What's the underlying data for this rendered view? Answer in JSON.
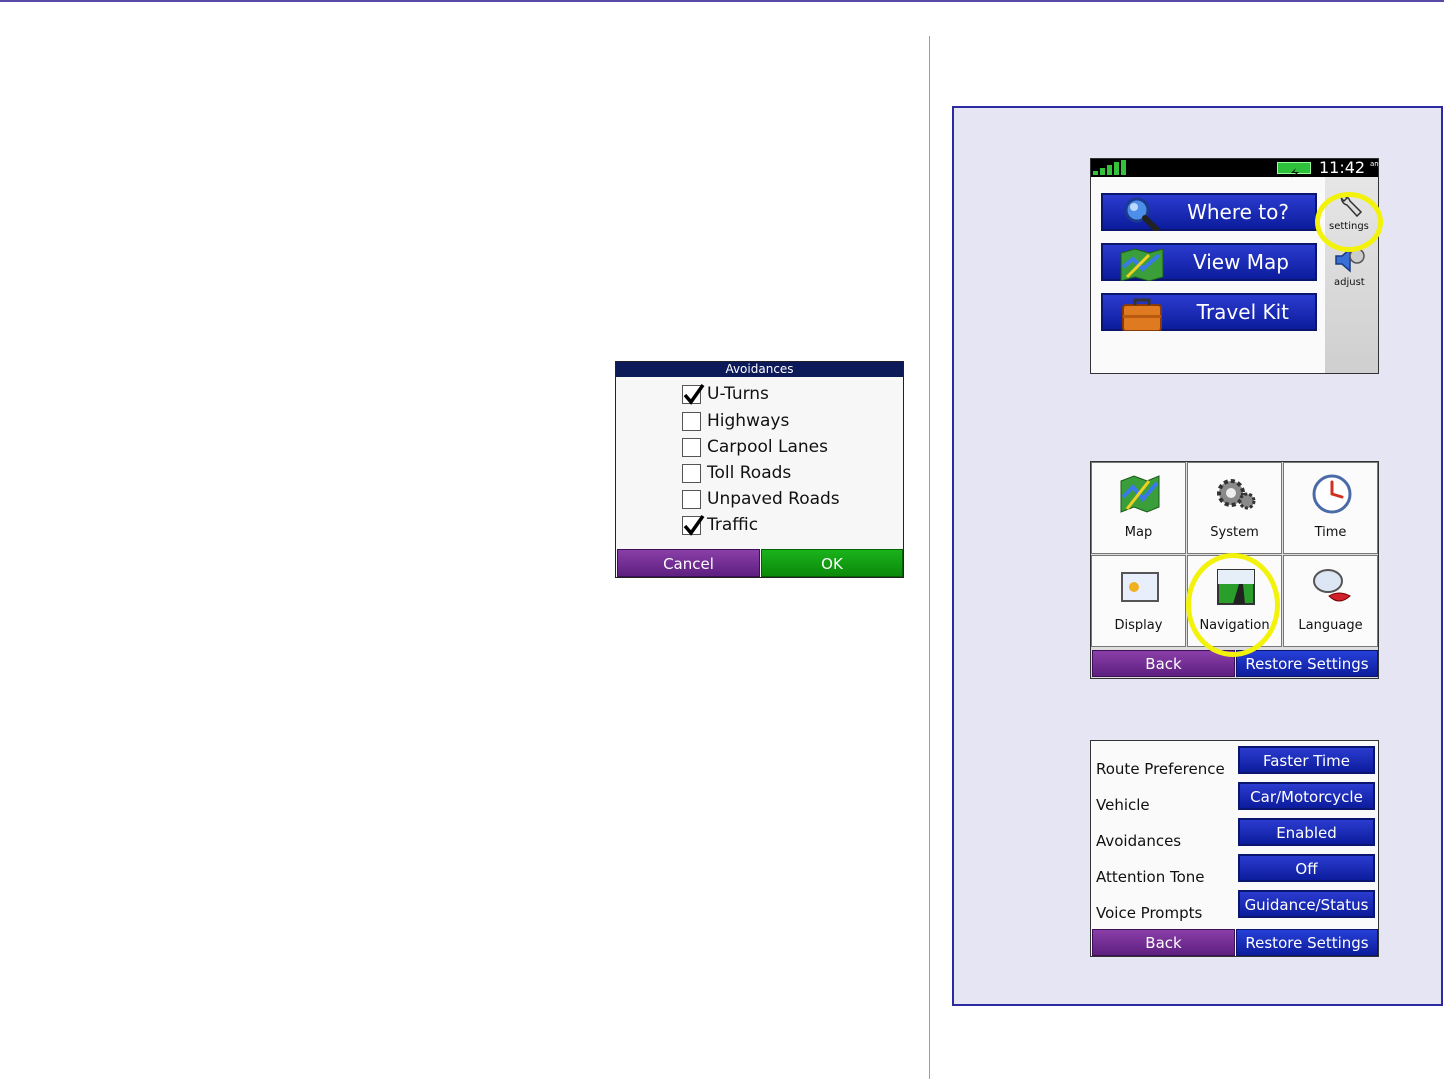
{
  "avoidances_dialog": {
    "title": "Avoidances",
    "items": [
      {
        "label": "U-Turns",
        "checked": true
      },
      {
        "label": "Highways",
        "checked": false
      },
      {
        "label": "Carpool Lanes",
        "checked": false
      },
      {
        "label": "Toll Roads",
        "checked": false
      },
      {
        "label": "Unpaved Roads",
        "checked": false
      },
      {
        "label": "Traffic",
        "checked": true
      }
    ],
    "cancel_label": "Cancel",
    "ok_label": "OK"
  },
  "main_menu": {
    "time": "11:42",
    "time_suffix": "am",
    "buttons": [
      {
        "label": "Where to?",
        "icon": "magnifier-icon"
      },
      {
        "label": "View Map",
        "icon": "map-icon"
      },
      {
        "label": "Travel Kit",
        "icon": "suitcase-icon"
      }
    ],
    "settings_label": "settings",
    "adjust_label": "adjust"
  },
  "settings_menu": {
    "items": [
      {
        "label": "Map",
        "icon": "map-icon"
      },
      {
        "label": "System",
        "icon": "gears-icon"
      },
      {
        "label": "Time",
        "icon": "clock-icon"
      },
      {
        "label": "Display",
        "icon": "display-icon"
      },
      {
        "label": "Navigation",
        "icon": "road-icon"
      },
      {
        "label": "Language",
        "icon": "speech-bubble-icon"
      }
    ],
    "back_label": "Back",
    "restore_label": "Restore Settings"
  },
  "navigation_settings": {
    "rows": [
      {
        "label": "Route Preference",
        "value": "Faster Time"
      },
      {
        "label": "Vehicle",
        "value": "Car/Motorcycle"
      },
      {
        "label": "Avoidances",
        "value": "Enabled"
      },
      {
        "label": "Attention Tone",
        "value": "Off"
      },
      {
        "label": "Voice Prompts",
        "value": "Guidance/Status"
      }
    ],
    "back_label": "Back",
    "restore_label": "Restore Settings"
  },
  "colors": {
    "highlight_ring": "#f2f20a",
    "button_blue": "#0c1c9c",
    "button_purple": "#5e1f80",
    "button_green": "#0a8a0a",
    "panel_bg": "#e5e5f3"
  }
}
